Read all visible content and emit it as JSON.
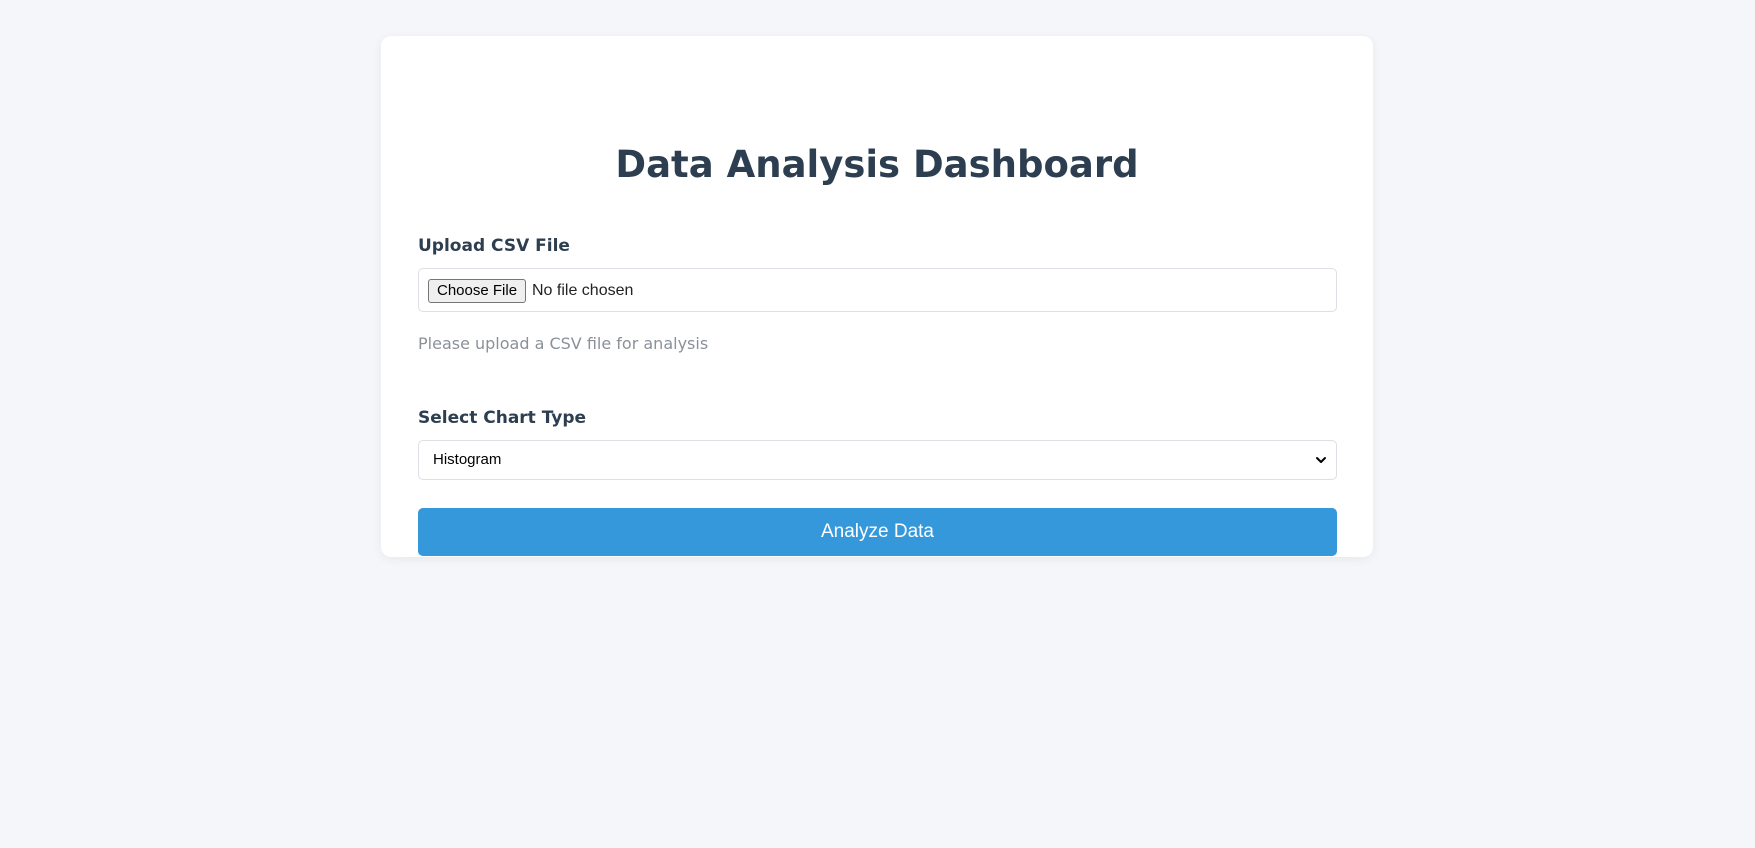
{
  "page": {
    "title": "Data Analysis Dashboard"
  },
  "upload": {
    "label": "Upload CSV File",
    "button_label": "Choose File",
    "status": "No file chosen",
    "hint": "Please upload a CSV file for analysis"
  },
  "chart": {
    "label": "Select Chart Type",
    "selected": "Histogram"
  },
  "actions": {
    "analyze_label": "Analyze Data"
  },
  "colors": {
    "accent": "#3498db",
    "heading": "#2c3e50",
    "background": "#f4f6fa"
  },
  "icons": {
    "select_arrow": "chevron-down-icon"
  }
}
